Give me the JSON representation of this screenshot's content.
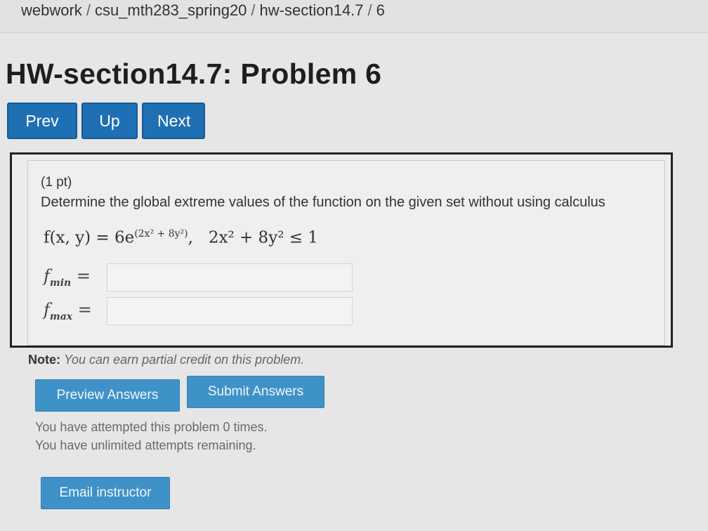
{
  "breadcrumb": {
    "items": [
      "webwork",
      "csu_mth283_spring20",
      "hw-section14.7",
      "6"
    ],
    "separator": "/"
  },
  "page_title": "HW-section14.7: Problem 6",
  "nav": {
    "prev_label": "Prev",
    "up_label": "Up",
    "next_label": "Next"
  },
  "problem": {
    "points": "(1 pt)",
    "question": "Determine the global extreme values of the function on the given set without using calculus",
    "formula": {
      "lhs": "f(x, y) = 6e",
      "exponent": "(2x² + 8y²)",
      "constraint": "2x² + 8y² ≤ 1"
    },
    "answers": [
      {
        "label": "f",
        "subscript": "min",
        "value": ""
      },
      {
        "label": "f",
        "subscript": "max",
        "value": ""
      }
    ]
  },
  "note": {
    "label": "Note:",
    "text": "You can earn partial credit on this problem."
  },
  "actions": {
    "preview_label": "Preview Answers",
    "submit_label": "Submit Answers",
    "email_label": "Email instructor"
  },
  "status": {
    "attempted": "You have attempted this problem 0 times.",
    "remaining": "You have unlimited attempts remaining."
  },
  "colors": {
    "nav_button": "#1f6fb4",
    "action_button": "#3f92c8",
    "box_border": "#222222"
  }
}
